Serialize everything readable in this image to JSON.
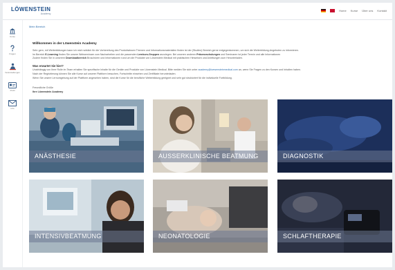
{
  "header": {
    "logo": "LÖWENSTEIN",
    "logo_sub": "Academy",
    "nav": [
      "Home",
      "Kurse",
      "Über uns",
      "Kontakt"
    ]
  },
  "sidebar": {
    "items": [
      {
        "label": "Kurse",
        "icon": "bank-icon"
      },
      {
        "label": "Fragen",
        "icon": "question-icon"
      },
      {
        "label": "Veranstaltungen",
        "icon": "person-icon"
      },
      {
        "label": "Profil",
        "icon": "card-icon"
      },
      {
        "label": "Info",
        "icon": "mail-icon"
      }
    ]
  },
  "breadcrumb": "Mein Bereich",
  "welcome": {
    "heading": "Willkommen in der Löwenstein Academy",
    "p1": "Sehr gern, mit Weiterbildungen kann ich mich wirklich für die Vorbereitung des Produktwissen Themen und Informationsmaterialien finden ist der (Studien) Bereich gerne entgegenkommen, um sich die Weiterbildung-Angeboten zu informieren.",
    "p2a": "Im Bereich",
    "p2b": "E-Learning",
    "p2c": "finden Sie unsere Webseminare zum Nacharbeiten und die passenden",
    "p2d": "Lernkurs-Gruppen",
    "p2e": "anzulegen. Bei unseren anderen",
    "p2f": "Präsenzschulungen",
    "p2g": "und Seminaren ist jeder Termin und alle Informationen",
    "p3a": "Zudem finden Sie in unserem",
    "p3b": "Downloadbereich",
    "p3c": "Broschüren und Informationen rund um die Produkte von Löwenstein Medical mit praktischen Hinweisen und Anleitungen zum Herunterladen."
  },
  "why": {
    "heading": "Was erwartet Sie hier?",
    "p1a": "Unabhängig von Ihrer Rolle im Team erhalten Sie spezifische Inhalte für die Geräte und Produkte von Löwenstein Medical. Bitte melden Sie sich unter",
    "p1b": "academy@loewensteinmedical.com",
    "p1c": "an, wenn Sie Fragen zu den Kursen und Inhalten haben.",
    "p2": "Nach der Registrierung können Sie alle Kurse auf unserer Plattform besuchen, Fortschritte einsehen und Zertifikate herunterladen.",
    "p3": "Wenn Sie unsere Lernumgebung auf der Plattform angesehen haben, sind die Kurse für die berufliche Weiterbildung geeignet und sehr gut strukturiert für die individuelle Fortbildung."
  },
  "signoff": {
    "greeting": "Freundliche Grüße",
    "team": "Ihre Löwenstein Academy"
  },
  "tiles": [
    {
      "label": "Anästhesie"
    },
    {
      "label": "Außerklinische Beatmung"
    },
    {
      "label": "Diagnostik"
    },
    {
      "label": "Intensivbeatmung"
    },
    {
      "label": "Neonatologie"
    },
    {
      "label": "Schlaftherapie"
    }
  ]
}
